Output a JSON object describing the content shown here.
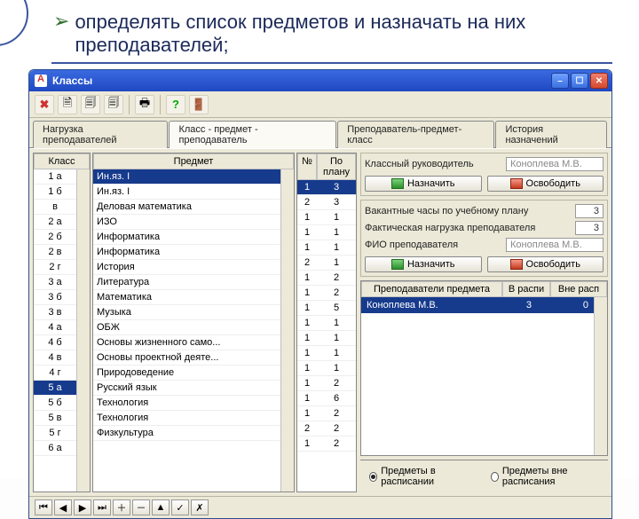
{
  "slide": {
    "bullet_text": "определять список предметов и назначать на них преподавателей;"
  },
  "window": {
    "title": "Классы",
    "tabs": [
      "Нагрузка преподавателей",
      "Класс - предмет - преподаватель",
      "Преподаватель-предмет-класс",
      "История назначений"
    ],
    "active_tab_index": 1
  },
  "left_grid": {
    "header": "Класс",
    "selected_index": 14,
    "rows": [
      "1 а",
      "1 б",
      "в",
      "2 а",
      "2 б",
      "2 в",
      "2 г",
      "3 а",
      "3 б",
      "3 в",
      "4 а",
      "4 б",
      "4 в",
      "4 г",
      "5 а",
      "5 б",
      "5 в",
      "5 г",
      "6 а"
    ]
  },
  "mid_grid": {
    "header": "Предмет",
    "selected_index": 0,
    "rows": [
      "Ин.яз. I",
      "Ин.яз. I",
      "Деловая математика",
      "ИЗО",
      "Информатика",
      "Информатика",
      "История",
      "Литература",
      "Математика",
      "Музыка",
      "ОБЖ",
      "Основы жизненного само...",
      "Основы проектной деяте...",
      "Природоведение",
      "Русский язык",
      "Технология",
      "Технология",
      "Физкультура"
    ]
  },
  "num_grid": {
    "headers": [
      "№",
      "По плану"
    ],
    "rows": [
      [
        1,
        3
      ],
      [
        2,
        3
      ],
      [
        1,
        1
      ],
      [
        1,
        1
      ],
      [
        1,
        1
      ],
      [
        2,
        1
      ],
      [
        1,
        2
      ],
      [
        1,
        2
      ],
      [
        1,
        5
      ],
      [
        1,
        1
      ],
      [
        1,
        1
      ],
      [
        1,
        1
      ],
      [
        1,
        1
      ],
      [
        1,
        2
      ],
      [
        1,
        6
      ],
      [
        1,
        2
      ],
      [
        2,
        2
      ],
      [
        1,
        2
      ]
    ],
    "selected_index": 0
  },
  "right_panel": {
    "card1": {
      "label": "Классный руководитель",
      "value": "Коноплева М.В.",
      "btn_assign": "Назначить",
      "btn_release": "Освободить"
    },
    "stats": {
      "row1_label": "Вакантные часы по учебному плану",
      "row1_value": "3",
      "row2_label": "Фактическая нагрузка преподавателя",
      "row2_value": "3",
      "row3_label": "ФИО преподавателя",
      "row3_value": "Коноплева М.В."
    },
    "card2": {
      "btn_assign": "Назначить",
      "btn_release": "Освободить"
    },
    "subgrid": {
      "headers": [
        "Преподаватели предмета",
        "В распи",
        "Вне расп"
      ],
      "rows": [
        {
          "name": "Коноплева М.В.",
          "in": 3,
          "out": 0
        }
      ],
      "selected_index": 0
    }
  },
  "radiobar": {
    "option1": "Предметы в расписании",
    "option2": "Предметы вне расписания",
    "selected": 0
  },
  "toolbar_icons": [
    "x-red-icon",
    "doc-1-icon",
    "doc-2-icon",
    "doc-3-icon",
    "print-icon",
    "help-icon",
    "exit-icon"
  ]
}
